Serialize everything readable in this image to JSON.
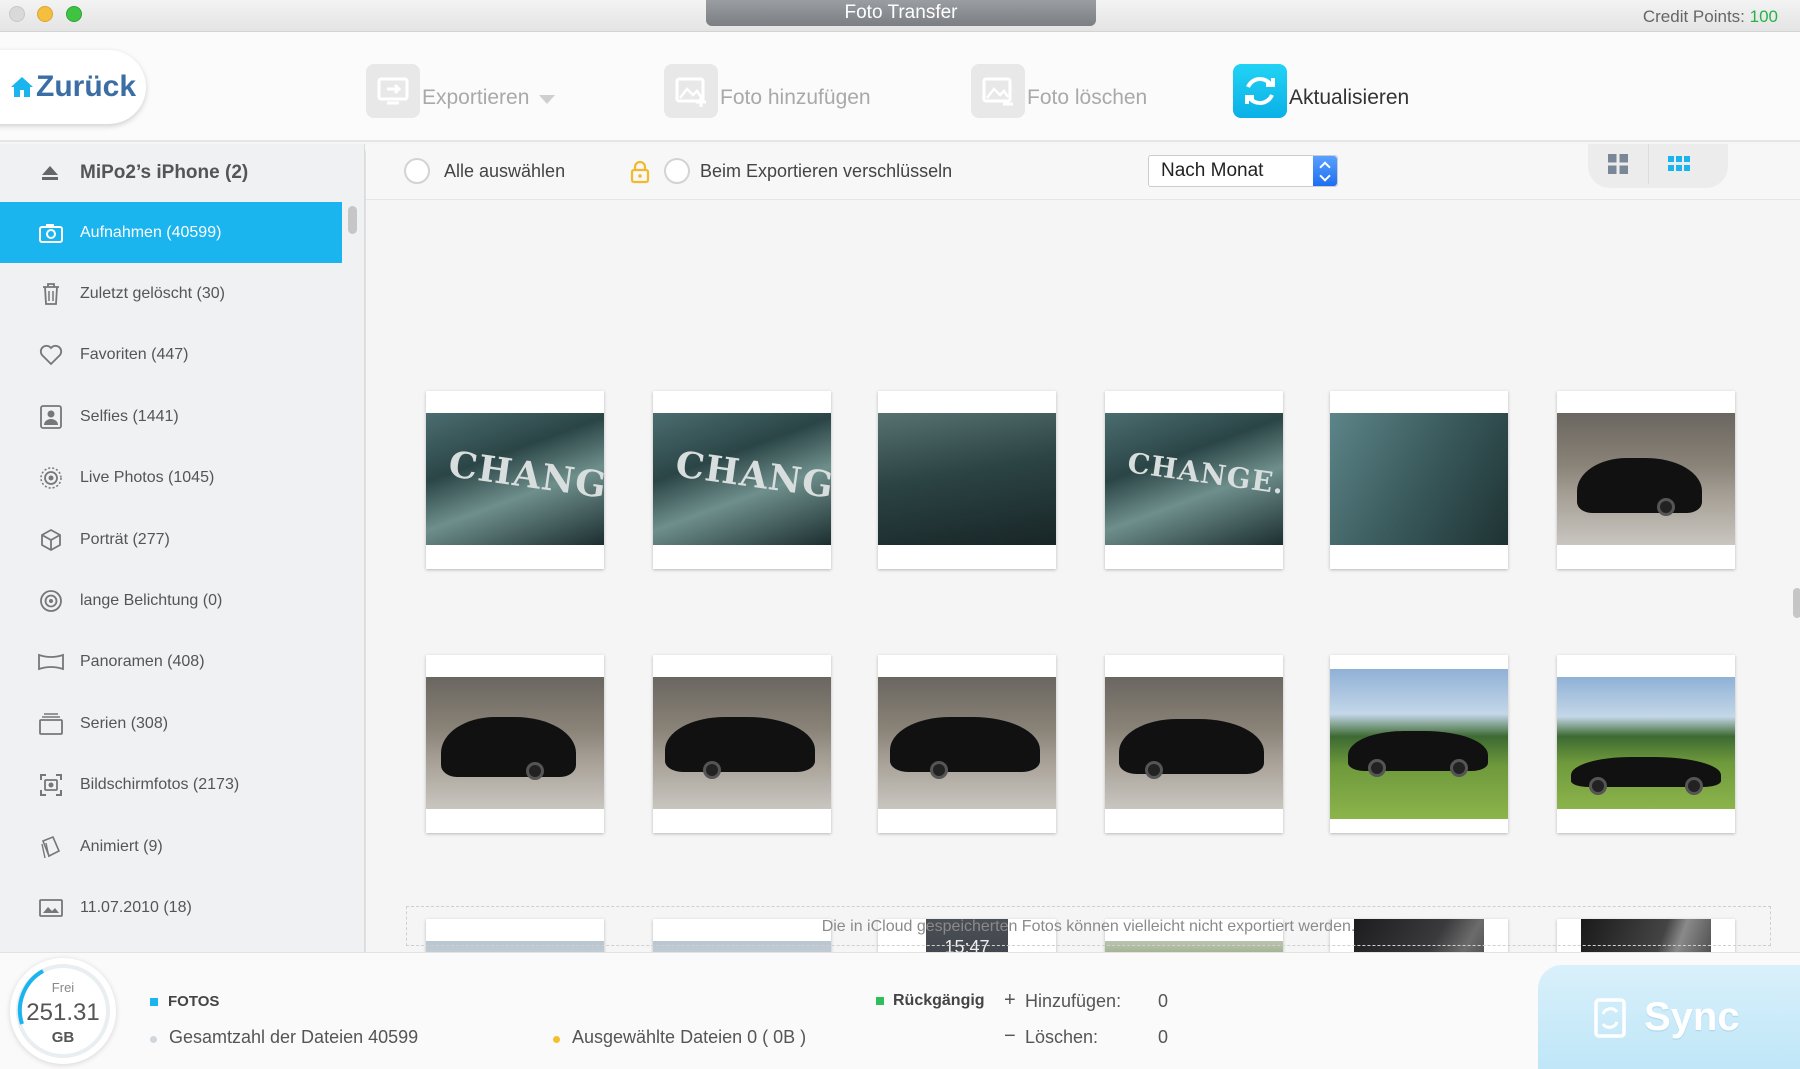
{
  "window": {
    "title": "Foto Transfer",
    "credit_label": "Credit Points:",
    "credit_value": "100"
  },
  "toolbar": {
    "back_label": "Zurück",
    "export_label": "Exportieren",
    "add_label": "Foto hinzufügen",
    "delete_label": "Foto löschen",
    "refresh_label": "Aktualisieren"
  },
  "sidebar": {
    "device": "MiPo2’s iPhone (2)",
    "albums": [
      {
        "label": "Aufnahmen (40599)",
        "icon": "camera-icon"
      },
      {
        "label": "Zuletzt gelöscht (30)",
        "icon": "trash-icon"
      },
      {
        "label": "Favoriten (447)",
        "icon": "heart-icon"
      },
      {
        "label": "Selfies (1441)",
        "icon": "portrait-frame-icon"
      },
      {
        "label": "Live Photos (1045)",
        "icon": "live-photo-icon"
      },
      {
        "label": "Porträt (277)",
        "icon": "cube-icon"
      },
      {
        "label": "lange Belichtung (0)",
        "icon": "long-exposure-icon"
      },
      {
        "label": "Panoramen (408)",
        "icon": "panorama-icon"
      },
      {
        "label": "Serien (308)",
        "icon": "burst-icon"
      },
      {
        "label": "Bildschirmfotos (2173)",
        "icon": "screenshot-icon"
      },
      {
        "label": "Animiert (9)",
        "icon": "animated-icon"
      },
      {
        "label": "11.07.2010 (18)",
        "icon": "photo-album-icon"
      }
    ]
  },
  "options": {
    "select_all": "Alle auswählen",
    "encrypt": "Beim Exportieren verschlüsseln",
    "sort_value": "Nach Monat"
  },
  "grid": {
    "icloud_note": "Die in iCloud gespeicherten Fotos können vielleicht nicht exportiert werden.",
    "phone_time": "15:47"
  },
  "status": {
    "gauge_label": "Frei",
    "gauge_value": "251.31",
    "gauge_unit": "GB",
    "section": "FOTOS",
    "total": "Gesamtzahl der Dateien 40599",
    "selected": "Ausgewählte Dateien 0 ( 0B )",
    "undo": "Rückgängig",
    "add_label": "Hinzufügen:",
    "add_value": "0",
    "delete_label": "Löschen:",
    "delete_value": "0",
    "sync_label": "Sync"
  },
  "colors": {
    "accent": "#1ab4ee",
    "credit": "#28b24b",
    "undo_marker": "#2fbf5a",
    "selected_dot": "#f2c12e"
  }
}
